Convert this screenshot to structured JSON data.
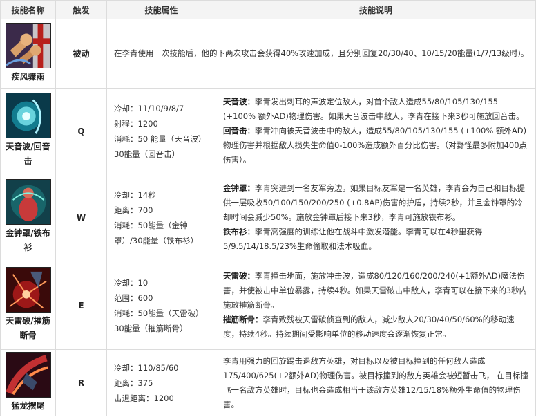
{
  "headers": {
    "name": "技能名称",
    "trigger": "触发",
    "attrs": "技能属性",
    "desc": "技能说明"
  },
  "passive": {
    "name": "疾风骤雨",
    "icon": "fist-wind-icon",
    "trigger": "被动",
    "desc": "在李青使用一次技能后，他的下两次攻击会获得40%攻速加成，且分别回复20/30/40、10/15/20能量(1/7/13级时)。"
  },
  "q": {
    "name": "天音波/回音击",
    "icon": "sonic-wave-icon",
    "trigger": "Q",
    "attrs": [
      "冷却：11/10/9/8/7",
      "射程：1200",
      "消耗：50 能量（天音波）30能量（回音击）"
    ],
    "desc1_title": "天音波：",
    "desc1_text": "李青发出刺耳的声波定位敌人，对首个敌人造成55/80/105/130/155 (+100% 额外AD)物理伤害。如果天音波击中敌人，李青在接下来3秒可施放回音击。",
    "desc2_title": "回音击：",
    "desc2_text": "李青冲向被天音波击中的敌人，造成55/80/105/130/155 (+100% 额外AD)物理伤害并根据敌人损失生命值0-100%造成额外百分比伤害。（对野怪最多附加400点伤害）。"
  },
  "w": {
    "name": "金钟罩/铁布衫",
    "icon": "safeguard-icon",
    "trigger": "W",
    "attrs": [
      "冷却：14秒",
      "距离：700",
      "消耗：50能量（金钟罩）/30能量（铁布衫）"
    ],
    "desc1_title": "金钟罩：",
    "desc1_text": "李青突进到一名友军旁边。如果目标友军是一名英雄，李青会为自己和目标提供一层吸收50/100/150/200/250 (+0.8AP)伤害的护盾，持续2秒，并且金钟罩的冷却时间会减少50%。施放金钟罩后接下来3秒，李青可施放铁布衫。",
    "desc2_title": "铁布衫：",
    "desc2_text": "李青高强度的训练让他在战斗中激发潜能。李青可以在4秒里获得5/9.5/14/18.5/23%生命偷取和法术吸血。"
  },
  "e": {
    "name": "天雷破/摧筋断骨",
    "icon": "tempest-icon",
    "trigger": "E",
    "attrs": [
      "冷却：10",
      "范围：600",
      "消耗：50能量（天雷破）30能量（摧筋断骨）"
    ],
    "desc1_title": "天雷破：",
    "desc1_text": "李青撞击地面，施放冲击波，造成80/120/160/200/240(+1额外AD)魔法伤害，并使被击中单位暴露，持续4秒。如果天雷破击中敌人，李青可以在接下来的3秒内施放摧筋断骨。",
    "desc2_title": "摧筋断骨：",
    "desc2_text": "李青致残被天雷破侦查到的敌人，减少敌人20/30/40/50/60%的移动速度，持续4秒。持续期间受影响单位的移动速度会逐渐恢复正常。"
  },
  "r": {
    "name": "猛龙摆尾",
    "icon": "dragon-rage-icon",
    "trigger": "R",
    "attrs": [
      "冷却：110/85/60",
      "距离：375",
      "击退距离：1200"
    ],
    "desc_text": "李青用强力的回旋踢击退敌方英雄，对目标以及被目标撞到的任何敌人造成175/400/625(+2额外AD)物理伤害。被目标撞到的敌方英雄会被短暂击飞， 在目标撞飞一名敌方英雄时，目标也会造成相当于该敌方英雄12/15/18%额外生命值的物理伤害。"
  }
}
